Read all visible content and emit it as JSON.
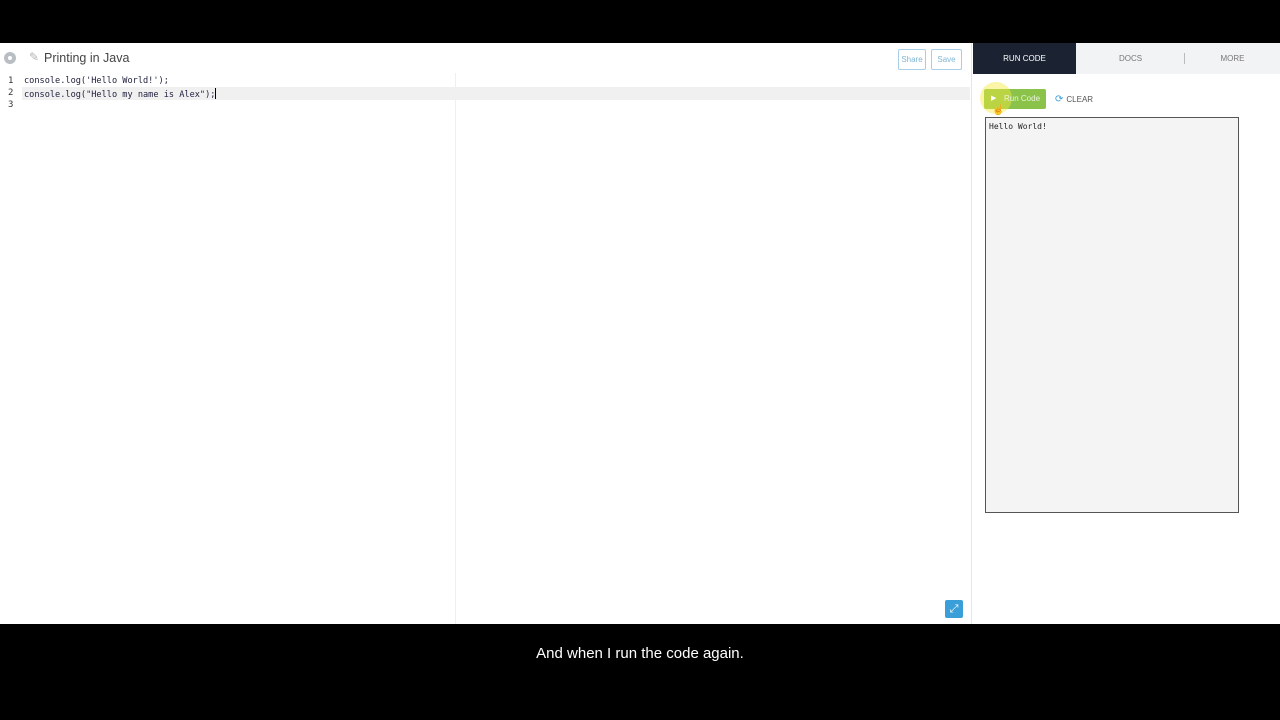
{
  "editor": {
    "file_title": "Printing in Java",
    "share_label": "Share",
    "save_label": "Save",
    "line_numbers": [
      "1",
      "2",
      "3"
    ],
    "code_lines": [
      "console.log('Hello World!');",
      "console.log(\"Hello my name is Alex\");",
      ""
    ]
  },
  "right_panel": {
    "tabs": {
      "run_code": "RUN CODE",
      "docs": "DOCS",
      "more": "MORE"
    },
    "run_button_label": "Run Code",
    "clear_label": "CLEAR",
    "console_output": [
      "Hello World!"
    ]
  },
  "subtitle": "And when I run the code again.",
  "colors": {
    "accent_blue": "#3a9fd8",
    "run_green": "#8bc34a",
    "active_tab": "#1b2333"
  },
  "icons": [
    "settings-icon",
    "pencil-icon",
    "play-icon",
    "refresh-icon",
    "expand-icon"
  ]
}
